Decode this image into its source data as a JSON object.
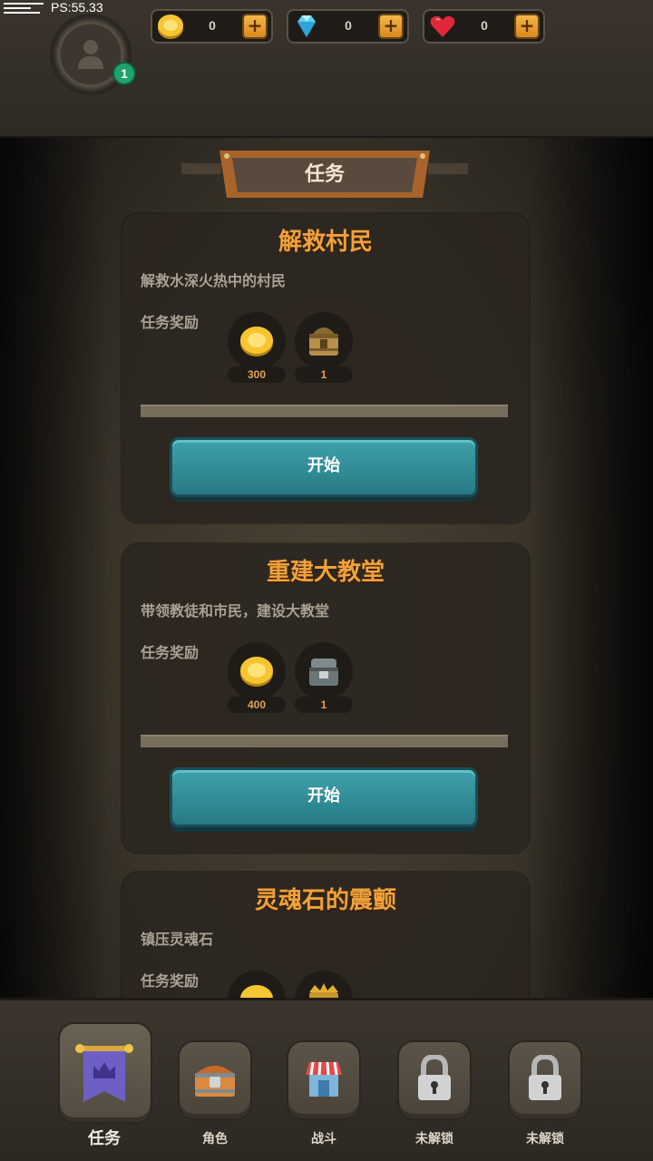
{
  "debug": {
    "fps_text": "PS:55.33"
  },
  "player": {
    "level": "1",
    "avatar_icon": "person-icon"
  },
  "currencies": [
    {
      "name": "gold",
      "icon": "gold-coin-icon",
      "value": "0"
    },
    {
      "name": "diamond",
      "icon": "diamond-icon",
      "value": "0"
    },
    {
      "name": "heart",
      "icon": "heart-icon",
      "value": "0"
    }
  ],
  "plus_label": "+",
  "title": "任务",
  "tasks": [
    {
      "title": "解救村民",
      "description": "解救水深火热中的村民",
      "reward_label": "任务奖励",
      "rewards": [
        {
          "icon": "gold-coin-icon",
          "count": "300"
        },
        {
          "icon": "wooden-chest-icon",
          "count": "1"
        }
      ],
      "button": "开始"
    },
    {
      "title": "重建大教堂",
      "description": "带领教徒和市民，建设大教堂",
      "reward_label": "任务奖励",
      "rewards": [
        {
          "icon": "gold-coin-icon",
          "count": "400"
        },
        {
          "icon": "iron-chest-icon",
          "count": "1"
        }
      ],
      "button": "开始"
    },
    {
      "title": "灵魂石的震颤",
      "description": "镇压灵魂石",
      "reward_label": "任务奖励",
      "rewards": [
        {
          "icon": "gold-coin-icon",
          "count": ""
        },
        {
          "icon": "gold-chest-icon",
          "count": ""
        }
      ],
      "button": ""
    }
  ],
  "nav": [
    {
      "label": "任务",
      "icon": "banner-crown-icon",
      "active": true
    },
    {
      "label": "角色",
      "icon": "treasure-chest-icon",
      "active": false
    },
    {
      "label": "战斗",
      "icon": "shop-icon",
      "active": false
    },
    {
      "label": "未解锁",
      "icon": "padlock-icon",
      "active": false
    },
    {
      "label": "未解锁",
      "icon": "padlock-icon",
      "active": false
    }
  ]
}
